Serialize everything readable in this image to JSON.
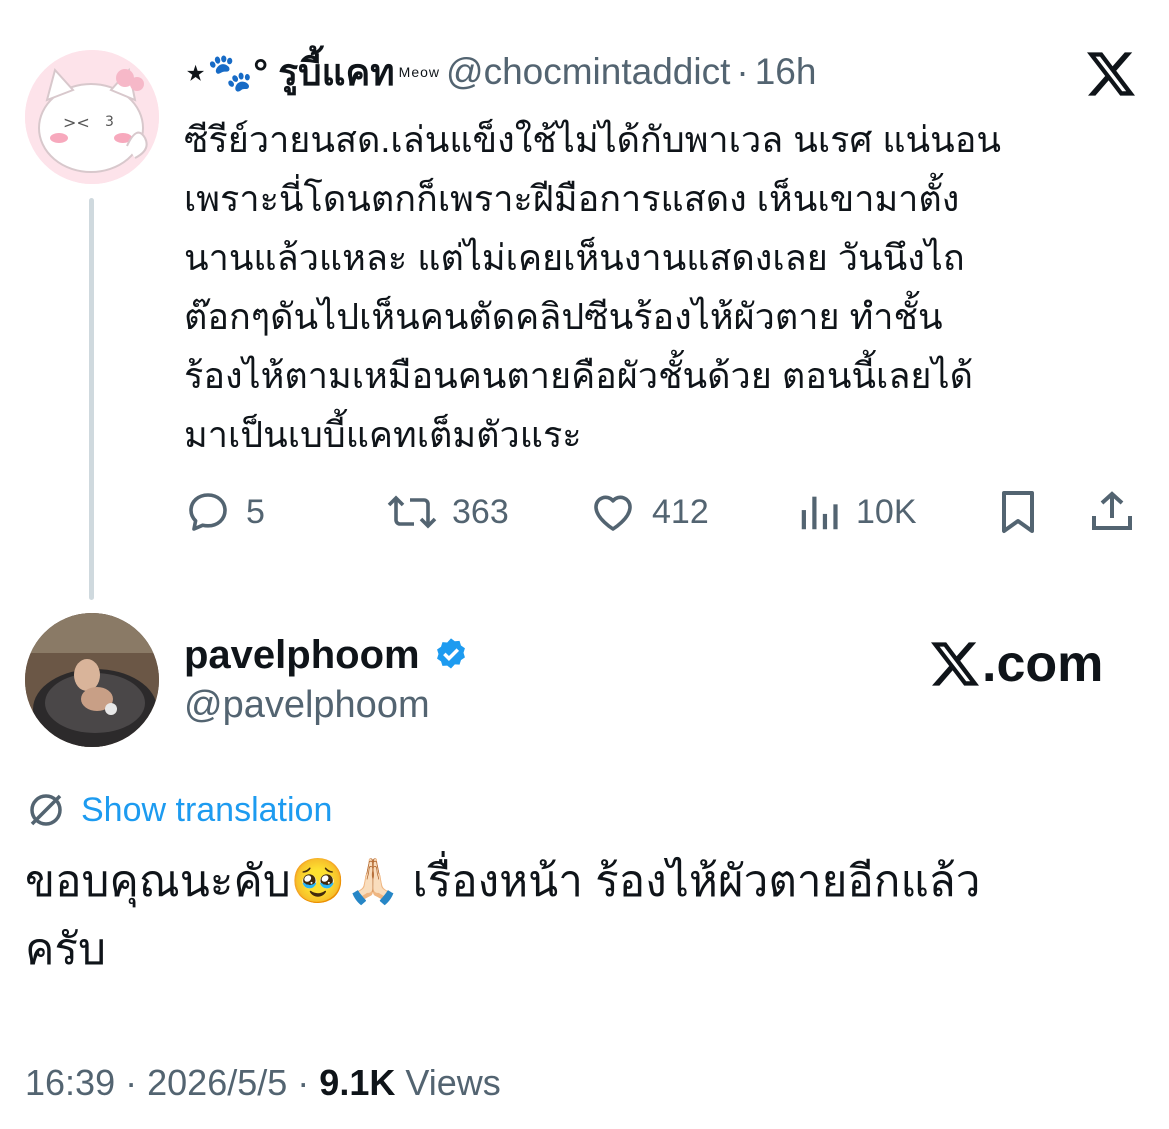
{
  "reply": {
    "display_name": "⋆🐾° รูบี้แคท",
    "name_suffix": "♡\nMeow",
    "meow_label": "Meow",
    "handle": "@chocmintaddict",
    "separator": "·",
    "time": "16h",
    "text": "ซีรีย์วายนสด.เล่นแข็งใช้ไม่ได้กับพาเวล นเรศ แน่นอน\nเพราะนี่โดนตกก็เพราะฝีมือการแสดง เห็นเขามาตั้ง\nนานแล้วแหละ แต่ไม่เคยเห็นงานแสดงเลย วันนึงไถ\nต๊อกๆดันไปเห็นคนตัดคลิปซีนร้องไห้ผัวตาย ทำชั้น\nร้องไห้ตามเหมือนคนตายคือผัวชั้นด้วย ตอนนี้เลยได้\nมาเป็นเบบี้แคทเต็มตัวแระ",
    "actions": {
      "replies": "5",
      "reposts": "363",
      "likes": "412",
      "views": "10K"
    }
  },
  "main": {
    "display_name": "pavelphoom",
    "handle": "@pavelphoom",
    "watermark": ".com",
    "show_translation": "Show translation",
    "text": "ขอบคุณนะคับ🥹🙏🏻 เรื่องหน้า ร้องไห้ผัวตายอีกแล้ว\nครับ",
    "footer": {
      "time": "16:39",
      "dot1": "·",
      "date": "2026/5/5",
      "dot2": "·",
      "views_count": "9.1K",
      "views_label": "Views"
    }
  },
  "colors": {
    "text": "#0f1419",
    "secondary": "#536471",
    "accent": "#1d9bf0",
    "thread_line": "#cfd9de"
  },
  "icons": [
    "x-logo-icon",
    "reply-icon",
    "repost-icon",
    "like-icon",
    "views-icon",
    "bookmark-icon",
    "share-icon",
    "verified-badge-icon",
    "translate-icon"
  ]
}
